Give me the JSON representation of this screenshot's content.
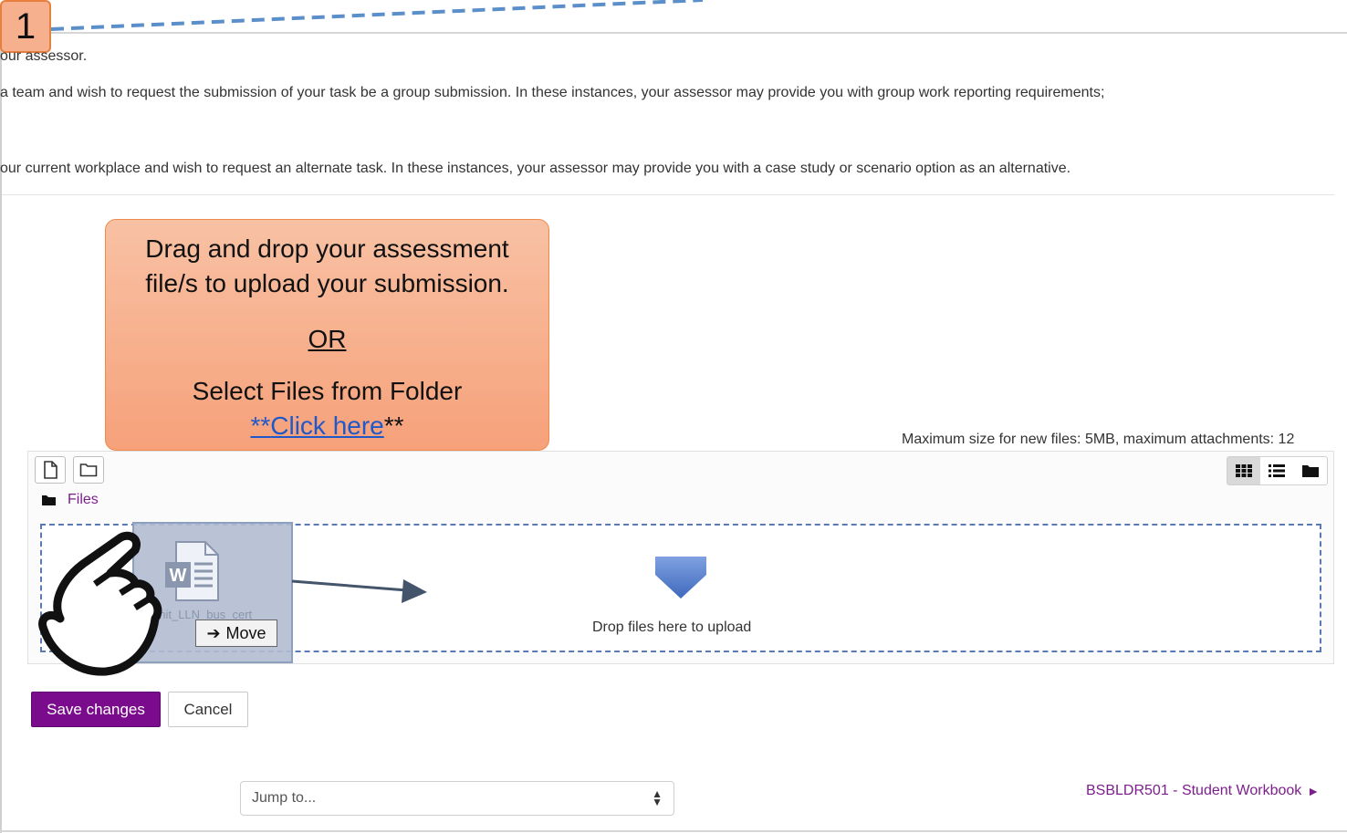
{
  "step_badge": "1",
  "intro_lines": [
    "our assessor.",
    "a team and wish to request the submission of your task be a group submission. In these instances, your assessor may provide you with group work reporting requirements;",
    "our current workplace and wish to request an alternate task. In these instances, your assessor may provide you with a case study or scenario option as an alternative."
  ],
  "callout": {
    "line1": "Drag and drop your assessment",
    "line2": "file/s to upload your submission.",
    "or": "OR",
    "select": "Select Files from Folder",
    "link_prefix": "**",
    "link_text": "Click here",
    "link_suffix": "**"
  },
  "filepicker": {
    "max_size": "Maximum size for new files: 5MB, maximum attachments: 12",
    "path_label": "Files",
    "drop_text": "Drop files here to upload",
    "drag_file_name": "unit_LLN_bus_cert",
    "move_label": "Move"
  },
  "buttons": {
    "save": "Save changes",
    "cancel": "Cancel"
  },
  "footer": {
    "jump_placeholder": "Jump to...",
    "next_link": "BSBLDR501 - Student Workbook"
  },
  "icons": {
    "add_file": "file-icon",
    "create_folder": "folder-icon",
    "view_icons": "grid-icon",
    "view_list": "list-icon",
    "view_tree": "folder-solid-icon",
    "drop_arrow": "arrow-down-icon",
    "word_doc": "word-document-icon",
    "hand": "hand-pointer-icon",
    "next": "triangle-right-icon"
  },
  "colors": {
    "accent": "#7a0b8c",
    "callout": "#f6a17a",
    "link": "#1f58c9",
    "drop_border": "#5b79b4"
  }
}
